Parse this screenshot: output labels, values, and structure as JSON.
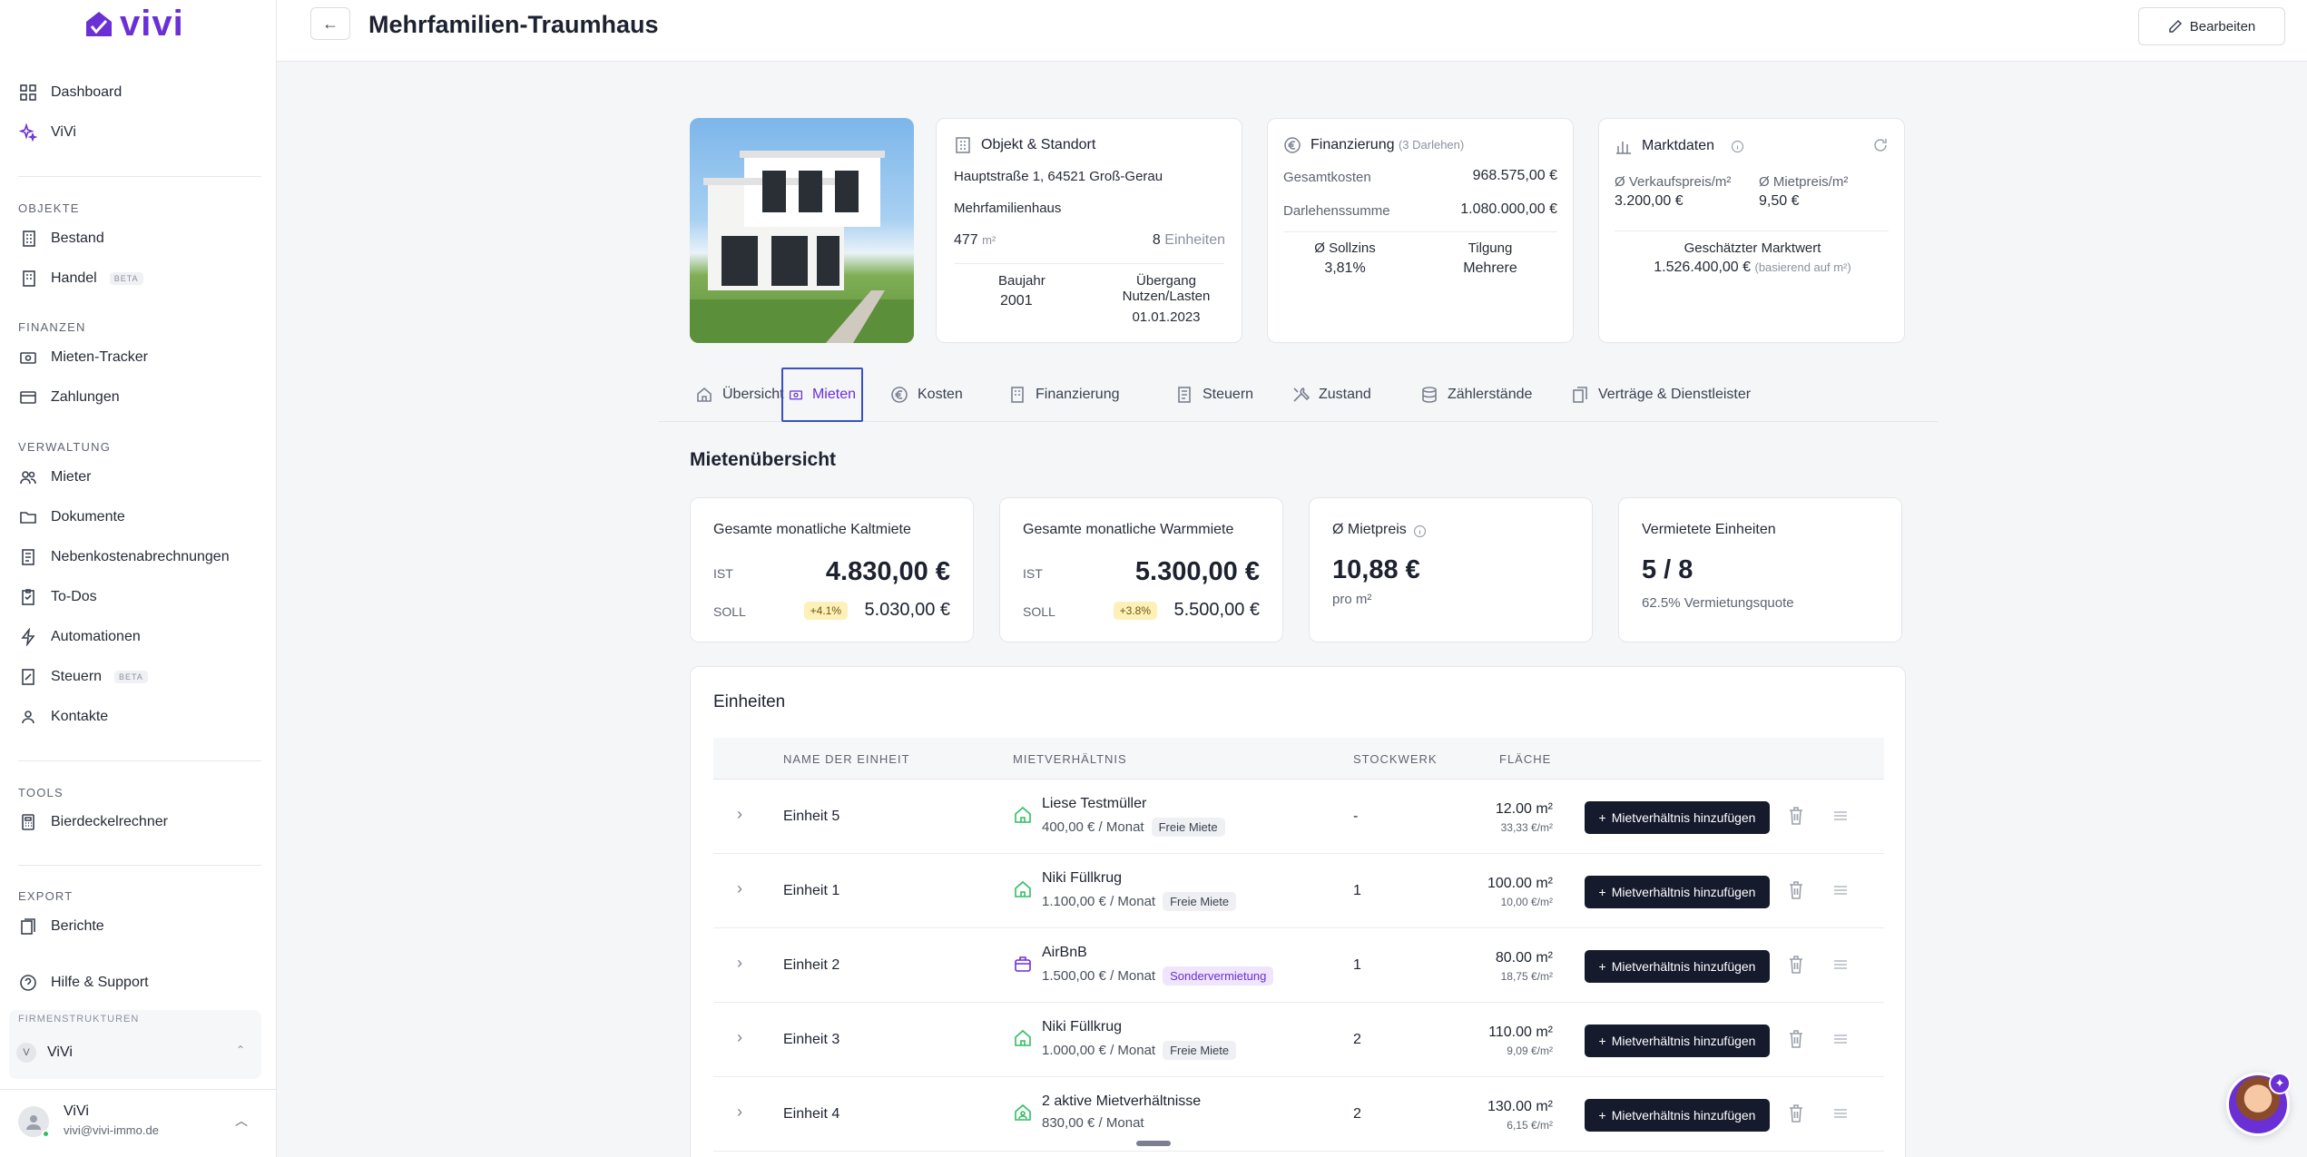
{
  "brand": {
    "name": "vivi",
    "accent": "#6b2fd6"
  },
  "sidebar": {
    "top": [
      {
        "label": "Dashboard",
        "icon": "grid-icon"
      },
      {
        "label": "ViVi",
        "icon": "sparkle-icon"
      }
    ],
    "sections": [
      {
        "title": "OBJEKTE",
        "items": [
          {
            "label": "Bestand"
          },
          {
            "label": "Handel",
            "badge": "BETA"
          }
        ]
      },
      {
        "title": "FINANZEN",
        "items": [
          {
            "label": "Mieten-Tracker"
          },
          {
            "label": "Zahlungen"
          }
        ]
      },
      {
        "title": "VERWALTUNG",
        "items": [
          {
            "label": "Mieter"
          },
          {
            "label": "Dokumente"
          },
          {
            "label": "Nebenkostenabrechnungen"
          },
          {
            "label": "To-Dos"
          },
          {
            "label": "Automationen"
          },
          {
            "label": "Steuern",
            "badge": "BETA"
          },
          {
            "label": "Kontakte"
          }
        ]
      },
      {
        "title": "TOOLS",
        "items": [
          {
            "label": "Bierdeckelrechner"
          }
        ]
      },
      {
        "title": "EXPORT",
        "items": [
          {
            "label": "Berichte"
          }
        ]
      }
    ],
    "help": "Hilfe & Support",
    "company": {
      "label": "FIRMENSTRUKTUREN",
      "initial": "V",
      "name": "ViVi"
    },
    "user": {
      "name": "ViVi",
      "email": "vivi@vivi-immo.de"
    }
  },
  "header": {
    "back": "←",
    "title": "Mehrfamilien-Traumhaus",
    "edit": "Bearbeiten"
  },
  "property": {
    "title": "Objekt & Standort",
    "address": "Hauptstraße 1, 64521 Groß-Gerau",
    "type": "Mehrfamilienhaus",
    "area_value": "477",
    "area_unit": "m²",
    "units_count": "8",
    "units_label": "Einheiten",
    "year_label": "Baujahr",
    "year": "2001",
    "transfer_label_1": "Übergang",
    "transfer_label_2": "Nutzen/Lasten",
    "transfer_date": "01.01.2023"
  },
  "financing": {
    "title": "Finanzierung",
    "subtitle": "(3 Darlehen)",
    "total_cost_label": "Gesamtkosten",
    "total_cost": "968.575,00 €",
    "loan_sum_label": "Darlehenssumme",
    "loan_sum": "1.080.000,00 €",
    "rate_label": "Ø Sollzins",
    "rate": "3,81%",
    "repay_label": "Tilgung",
    "repay": "Mehrere"
  },
  "market": {
    "title": "Marktdaten",
    "sale_label": "Ø Verkaufspreis/m²",
    "sale": "3.200,00 €",
    "rent_label": "Ø Mietpreis/m²",
    "rent": "9,50 €",
    "value_label": "Geschätzter Marktwert",
    "value": "1.526.400,00 €",
    "value_note": "(basierend auf m²)"
  },
  "tabs": [
    {
      "label": "Übersicht"
    },
    {
      "label": "Mieten"
    },
    {
      "label": "Kosten"
    },
    {
      "label": "Finanzierung"
    },
    {
      "label": "Steuern"
    },
    {
      "label": "Zustand"
    },
    {
      "label": "Zählerstände"
    },
    {
      "label": "Verträge & Dienstleister"
    }
  ],
  "overview": {
    "title": "Mietenübersicht",
    "kalt": {
      "title": "Gesamte monatliche Kaltmiete",
      "ist_label": "IST",
      "ist": "4.830,00 €",
      "soll_label": "SOLL",
      "delta": "+4.1%",
      "soll": "5.030,00 €"
    },
    "warm": {
      "title": "Gesamte monatliche Warmmiete",
      "ist_label": "IST",
      "ist": "5.300,00 €",
      "soll_label": "SOLL",
      "delta": "+3.8%",
      "soll": "5.500,00 €"
    },
    "price": {
      "title": "Ø Mietpreis",
      "value": "10,88 €",
      "sub": "pro m²"
    },
    "rented": {
      "title": "Vermietete Einheiten",
      "value": "5 / 8",
      "sub": "62.5% Vermietungsquote"
    }
  },
  "units": {
    "title": "Einheiten",
    "columns": {
      "name": "NAME DER EINHEIT",
      "tenancy": "MIETVERHÄLTNIS",
      "floor": "STOCKWERK",
      "area": "FLÄCHE"
    },
    "add_label": "Mietverhältnis hinzufügen",
    "rows": [
      {
        "name": "Einheit 5",
        "tenant": "Liese Testmüller",
        "rent": "400,00 € / Monat",
        "tag": "Freie Miete",
        "floor": "-",
        "area": "12.00 m²",
        "per": "33,33 €/m²"
      },
      {
        "name": "Einheit 1",
        "tenant": "Niki Füllkrug",
        "rent": "1.100,00 € / Monat",
        "tag": "Freie Miete",
        "floor": "1",
        "area": "100.00 m²",
        "per": "10,00 €/m²"
      },
      {
        "name": "Einheit 2",
        "tenant": "AirBnB",
        "rent": "1.500,00 € / Monat",
        "tag": "Sondervermietung",
        "floor": "1",
        "area": "80.00 m²",
        "per": "18,75 €/m²"
      },
      {
        "name": "Einheit 3",
        "tenant": "Niki Füllkrug",
        "rent": "1.000,00 € / Monat",
        "tag": "Freie Miete",
        "floor": "2",
        "area": "110.00 m²",
        "per": "9,09 €/m²"
      },
      {
        "name": "Einheit 4",
        "tenant": "2 aktive Mietverhältnisse",
        "rent": "830,00 € / Monat",
        "tag": "",
        "floor": "2",
        "area": "130.00 m²",
        "per": "6,15 €/m²"
      }
    ]
  }
}
